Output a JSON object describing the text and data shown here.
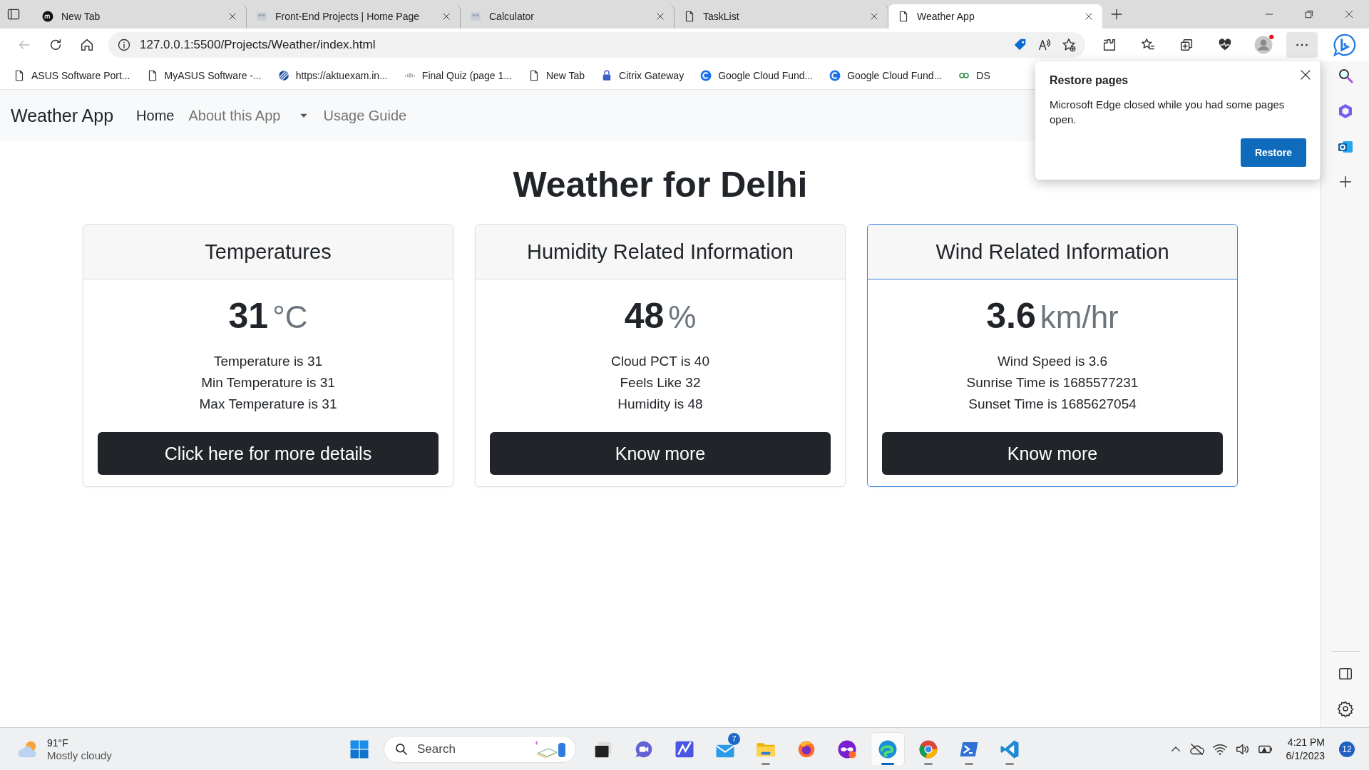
{
  "browser": {
    "tabs": [
      {
        "title": "New Tab",
        "kind": "dark-circle",
        "selected": false
      },
      {
        "title": "Front-End Projects | Home Page",
        "kind": "thumbnail",
        "selected": false
      },
      {
        "title": "Calculator",
        "kind": "thumbnail",
        "selected": false
      },
      {
        "title": "TaskList",
        "kind": "page",
        "selected": false
      },
      {
        "title": "Weather App",
        "kind": "page",
        "selected": true
      }
    ],
    "back": {
      "disabled": true
    },
    "address": "127.0.0.1:5500/Projects/Weather/index.html",
    "bookmarks": [
      {
        "label": "ASUS Software Port...",
        "kind": "page"
      },
      {
        "label": "MyASUS Software -...",
        "kind": "page"
      },
      {
        "label": "https://aktuexam.in...",
        "kind": "stripes"
      },
      {
        "label": "Final Quiz (page 1...",
        "kind": "bars"
      },
      {
        "label": "New Tab",
        "kind": "page"
      },
      {
        "label": "Citrix Gateway",
        "kind": "lock"
      },
      {
        "label": "Google Cloud Fund...",
        "kind": "c-logo"
      },
      {
        "label": "Google Cloud Fund...",
        "kind": "c-logo"
      },
      {
        "label": "DS",
        "kind": "rings"
      }
    ]
  },
  "navbar": {
    "brand": "Weather App",
    "links": [
      {
        "label": "Home",
        "selected": true,
        "dropdown": false
      },
      {
        "label": "About this App",
        "selected": false,
        "dropdown": true
      },
      {
        "label": "Usage Guide",
        "selected": false,
        "dropdown": false
      }
    ]
  },
  "heading": "Weather for Delhi",
  "cards": [
    {
      "title": "Temperatures",
      "value": "31",
      "unit": "°C",
      "lines": [
        "Temperature is 31",
        "Min Temperature is 31",
        "Max Temperature is 31"
      ],
      "button": "Click here for more details",
      "selected": false
    },
    {
      "title": "Humidity Related Information",
      "value": "48",
      "unit": "%",
      "lines": [
        "Cloud PCT is 40",
        "Feels Like 32",
        "Humidity is 48"
      ],
      "button": "Know more",
      "selected": false
    },
    {
      "title": "Wind Related Information",
      "value": "3.6",
      "unit": "km/hr",
      "lines": [
        "Wind Speed is 3.6",
        "Sunrise Time is 1685577231",
        "Sunset Time is 1685627054"
      ],
      "button": "Know more",
      "selected": true
    }
  ],
  "restore_popup": {
    "title": "Restore pages",
    "message": "Microsoft Edge closed while you had some pages open.",
    "button": "Restore"
  },
  "taskbar": {
    "weather": {
      "temperature": "91°F",
      "condition": "Mostly cloudy"
    },
    "search_placeholder": "Search",
    "apps": [
      {
        "kind": "task-view",
        "running": false,
        "selected": false
      },
      {
        "kind": "chat",
        "running": false,
        "selected": false
      },
      {
        "kind": "pen",
        "running": false,
        "selected": false
      },
      {
        "kind": "mail",
        "running": false,
        "selected": false,
        "badge": "7"
      },
      {
        "kind": "folder",
        "running": true,
        "selected": false
      },
      {
        "kind": "firefox",
        "running": false,
        "selected": false
      },
      {
        "kind": "mask",
        "running": false,
        "selected": false
      },
      {
        "kind": "edge",
        "running": true,
        "selected": true
      },
      {
        "kind": "chrome",
        "running": true,
        "selected": false
      },
      {
        "kind": "terminal",
        "running": true,
        "selected": false
      },
      {
        "kind": "vscode",
        "running": true,
        "selected": false
      }
    ],
    "time": "4:21 PM",
    "date": "6/1/2023",
    "notifications": "12"
  }
}
